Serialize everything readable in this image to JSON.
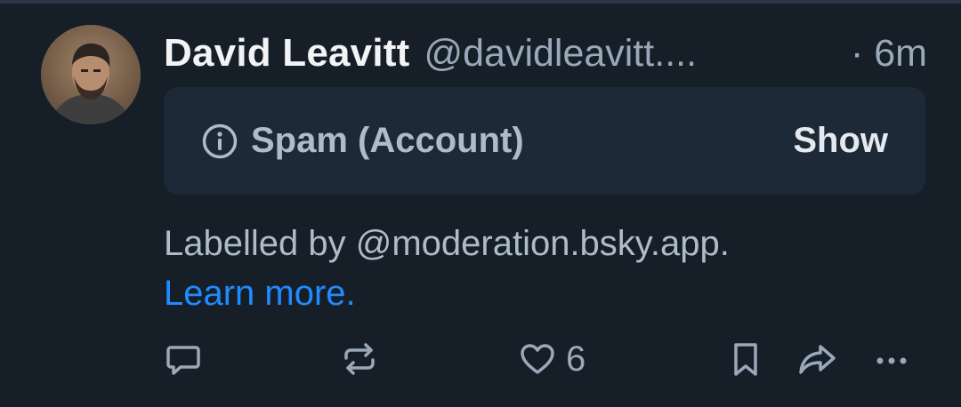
{
  "post": {
    "author_name": "David Leavitt",
    "author_handle": "@davidleavitt....",
    "time": "· 6m",
    "label": {
      "text": "Spam (Account)",
      "icon": "info-icon",
      "show_label": "Show"
    },
    "moderation_note": "Labelled by @moderation.bsky.app.",
    "learn_more": "Learn more.",
    "actions": {
      "reply_icon": "speech-bubble-icon",
      "repost_icon": "repost-arrows-icon",
      "like_icon": "heart-icon",
      "like_count": "6",
      "bookmark_icon": "bookmark-icon",
      "share_icon": "share-arrow-icon",
      "more_icon": "ellipsis-icon"
    }
  },
  "colors": {
    "background": "#161e27",
    "card": "#1e2937",
    "link": "#208bfe",
    "muted_text": "#9aa9b9"
  }
}
